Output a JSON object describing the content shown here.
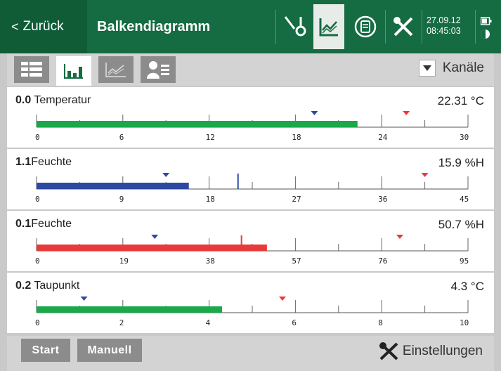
{
  "header": {
    "back_label": "Zurück",
    "title": "Balkendiagramm",
    "date": "27.09.12",
    "time": "08:45:03"
  },
  "toolbar": {
    "dropdown_label": "Kanäle"
  },
  "channels": [
    {
      "id": "0.0",
      "name": " Temperatur",
      "value": "22.31 °C",
      "ticks": [
        "0",
        "6",
        "12",
        "18",
        "24",
        "30"
      ],
      "bar_fraction": 0.744,
      "bar_color": "#1aa84a",
      "min_marker_fraction": 0.644,
      "max_marker_fraction": 0.857
    },
    {
      "id": "1.1",
      "name": "Feuchte",
      "value": "15.9 %H",
      "ticks": [
        "0",
        "9",
        "18",
        "27",
        "36",
        "45"
      ],
      "bar_fraction": 0.353,
      "bar_color": "#2e4aa0",
      "min_marker_fraction": 0.3,
      "max_marker_fraction": 0.9,
      "line_fraction": 0.467
    },
    {
      "id": "0.1",
      "name": "Feuchte",
      "value": "50.7 %H",
      "ticks": [
        "0",
        "19",
        "38",
        "57",
        "76",
        "95"
      ],
      "bar_fraction": 0.534,
      "bar_color": "#e83a3a",
      "min_marker_fraction": 0.274,
      "max_marker_fraction": 0.842,
      "line_fraction": 0.475
    },
    {
      "id": "0.2",
      "name": " Taupunkt",
      "value": "4.3 °C",
      "ticks": [
        "0",
        "2",
        "4",
        "6",
        "8",
        "10"
      ],
      "bar_fraction": 0.43,
      "bar_color": "#1aa84a",
      "min_marker_fraction": 0.11,
      "max_marker_fraction": 0.57
    }
  ],
  "bottom": {
    "start_label": "Start",
    "manual_label": "Manuell",
    "settings_label": "Einstellungen"
  }
}
